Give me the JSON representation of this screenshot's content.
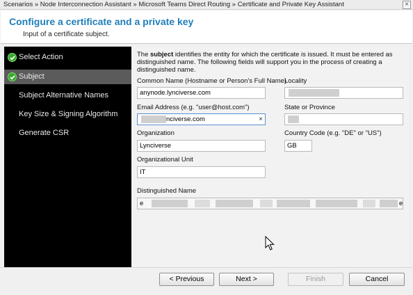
{
  "window": {
    "breadcrumb": "Scenarios » Node Interconnection Assistant » Microsoft Teams Direct Routing » Certificate and Private Key Assistant",
    "close_glyph": "×"
  },
  "header": {
    "title": "Configure a certificate and a private key",
    "subtitle": "Input of a certificate subject."
  },
  "steps": [
    {
      "label": "Select Action",
      "done": true,
      "active": false
    },
    {
      "label": "Subject",
      "done": true,
      "active": true
    },
    {
      "label": "Subject Alternative Names",
      "done": false,
      "active": false
    },
    {
      "label": "Key Size & Signing Algorithm",
      "done": false,
      "active": false
    },
    {
      "label": "Generate CSR",
      "done": false,
      "active": false
    }
  ],
  "description": {
    "prefix": "The ",
    "bold": "subject",
    "rest": " identifies the entity for which the certificate is issued. It must be entered as distinguished name. The following fields will support you in the process of creating a distinguished name."
  },
  "fields": {
    "common_name": {
      "label": "Common Name (Hostname or Person's Full Name)",
      "value": "anynode.lynciverse.com"
    },
    "locality": {
      "label": "Locality",
      "value": ""
    },
    "email": {
      "label": "Email Address (e.g. \"user@host.com\")",
      "value": "nciverse.com",
      "clear_glyph": "×"
    },
    "state": {
      "label": "State or Province",
      "value": ""
    },
    "organization": {
      "label": "Organization",
      "value": "Lynciverse"
    },
    "country": {
      "label": "Country Code (e.g. \"DE\" or \"US\")",
      "value": "GB"
    },
    "org_unit": {
      "label": "Organizational Unit",
      "value": "IT"
    },
    "dn": {
      "label": "Distinguished Name",
      "value_start": "e",
      "value_end": "e"
    }
  },
  "buttons": {
    "previous": "< Previous",
    "next": "Next >",
    "finish": "Finish",
    "cancel": "Cancel"
  },
  "colors": {
    "title": "#1f7fba",
    "sidebar_bg": "#000000",
    "active_step_bg": "#5b5b5b",
    "check_green": "#3aa52e"
  }
}
